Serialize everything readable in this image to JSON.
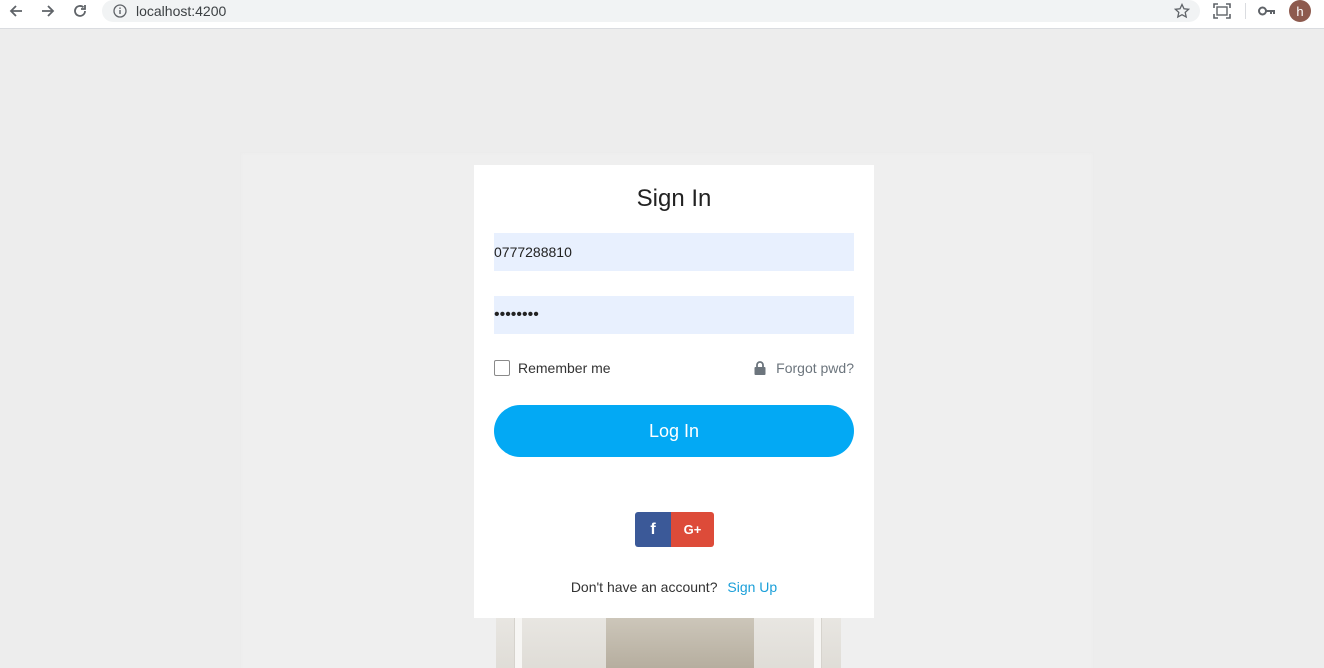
{
  "browser": {
    "url": "localhost:4200",
    "avatar_letter": "h",
    "icons": [
      "back-arrow-icon",
      "forward-arrow-icon",
      "reload-icon",
      "info-icon",
      "star-icon",
      "screen-capture-icon",
      "key-icon"
    ]
  },
  "login": {
    "title": "Sign In",
    "phone_value": "0777288810",
    "password_value": "••••••••",
    "remember_label": "Remember me",
    "forgot_label": "Forgot pwd?",
    "login_button": "Log In",
    "facebook_glyph": "f",
    "google_glyph": "G+",
    "no_account_text": "Don't have an account?",
    "signup_label": "Sign Up"
  },
  "colors": {
    "primary": "#03a9f4",
    "facebook": "#3b5998",
    "google": "#dd4b39",
    "input_bg": "#e8f0fe",
    "link": "#1a9fd9"
  }
}
